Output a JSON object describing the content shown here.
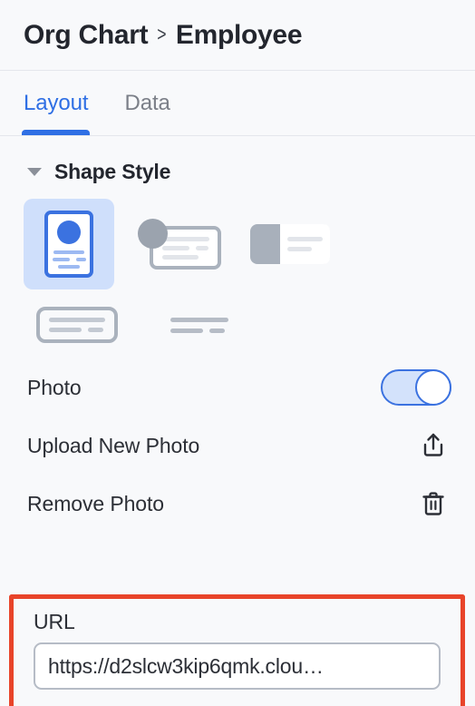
{
  "header": {
    "breadcrumb": {
      "parent": "Org Chart",
      "separator": ">",
      "current": "Employee"
    }
  },
  "tabs": [
    {
      "label": "Layout",
      "active": true
    },
    {
      "label": "Data",
      "active": false
    }
  ],
  "section": {
    "title": "Shape Style",
    "expanded": true,
    "caret_icon": "caret-down-icon"
  },
  "shape_styles": [
    {
      "name": "vertical-card-with-photo",
      "selected": true
    },
    {
      "name": "circle-photo-with-card",
      "selected": false
    },
    {
      "name": "split-block-card",
      "selected": false
    },
    {
      "name": "outlined-text-box",
      "selected": false
    },
    {
      "name": "text-lines-only",
      "selected": false
    }
  ],
  "options": {
    "photo": {
      "label": "Photo",
      "toggle_on": true
    },
    "upload": {
      "label": "Upload New Photo",
      "icon": "upload-icon"
    },
    "remove": {
      "label": "Remove Photo",
      "icon": "trash-icon"
    }
  },
  "url_field": {
    "label": "URL",
    "value": "https://d2slcw3kip6qmk.clou…",
    "placeholder": "https://",
    "highlight_color": "#e8442a"
  },
  "colors": {
    "accent": "#2f6fe4",
    "accent_soft": "#cfdffb",
    "background": "#f8f9fb",
    "text": "#23262e",
    "muted": "#7b7f88",
    "highlight": "#e8442a"
  }
}
